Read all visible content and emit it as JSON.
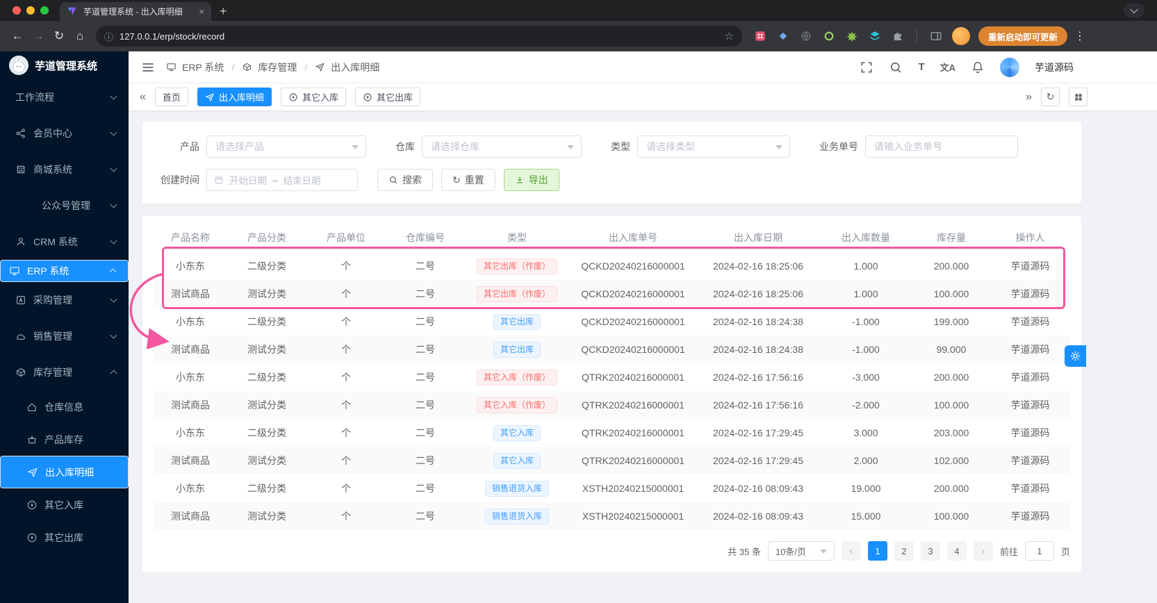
{
  "browser": {
    "tab_title": "芋道管理系统 - 出入库明细",
    "url": "127.0.0.1/erp/stock/record",
    "update_label": "重新启动即可更新"
  },
  "glyphs": {
    "back": "←",
    "forward": "→",
    "reload": "↻",
    "home": "⌂",
    "info": "ⓘ",
    "star": "☆",
    "menu_dots": "⋮",
    "new_tab": "+",
    "close_tab": "×",
    "collapse_left": "«",
    "expand_right": "»",
    "refresh": "↻",
    "size_icon": "T",
    "translate_icon": "文A",
    "page_prev": "‹",
    "page_next": "›",
    "breadcrumb_sep": "/",
    "range_sep": "–"
  },
  "sidebar": {
    "logo_text": "芋道管理系统",
    "items": [
      {
        "label": "工作流程"
      },
      {
        "label": "会员中心"
      },
      {
        "label": "商城系统"
      },
      {
        "label": "公众号管理"
      },
      {
        "label": "CRM 系统"
      },
      {
        "label": "ERP 系统"
      },
      {
        "label": "采购管理"
      },
      {
        "label": "销售管理"
      },
      {
        "label": "库存管理"
      },
      {
        "label": "仓库信息"
      },
      {
        "label": "产品库存"
      },
      {
        "label": "出入库明细"
      },
      {
        "label": "其它入库"
      },
      {
        "label": "其它出库"
      }
    ]
  },
  "header": {
    "breadcrumb": [
      {
        "label": "ERP 系统"
      },
      {
        "label": "库存管理"
      },
      {
        "label": "出入库明细"
      }
    ],
    "username": "芋道源码"
  },
  "tags": [
    {
      "label": "首页"
    },
    {
      "label": "出入库明细"
    },
    {
      "label": "其它入库"
    },
    {
      "label": "其它出库"
    }
  ],
  "filter": {
    "product_label": "产品",
    "product_placeholder": "请选择产品",
    "warehouse_label": "仓库",
    "warehouse_placeholder": "请选择仓库",
    "type_label": "类型",
    "type_placeholder": "请选择类型",
    "bizno_label": "业务单号",
    "bizno_placeholder": "请输入业务单号",
    "time_label": "创建时间",
    "time_start": "开始日期",
    "time_end": "结束日期",
    "search_label": "搜索",
    "reset_label": "重置",
    "export_label": "导出"
  },
  "table": {
    "headers": [
      "产品名称",
      "产品分类",
      "产品单位",
      "仓库编号",
      "类型",
      "出入库单号",
      "出入库日期",
      "出入库数量",
      "库存量",
      "操作人"
    ],
    "rows": [
      {
        "product": "小东东",
        "category": "二级分类",
        "unit": "个",
        "warehouse": "二号",
        "type": "其它出库（作废）",
        "type_variant": "danger",
        "order_no": "QCKD20240216000001",
        "datetime": "2024-02-16 18:25:06",
        "quantity": "1.000",
        "stock": "200.000",
        "operator": "芋道源码"
      },
      {
        "product": "测试商品",
        "category": "测试分类",
        "unit": "个",
        "warehouse": "二号",
        "type": "其它出库（作废）",
        "type_variant": "danger",
        "order_no": "QCKD20240216000001",
        "datetime": "2024-02-16 18:25:06",
        "quantity": "1.000",
        "stock": "100.000",
        "operator": "芋道源码"
      },
      {
        "product": "小东东",
        "category": "二级分类",
        "unit": "个",
        "warehouse": "二号",
        "type": "其它出库",
        "type_variant": "primary",
        "order_no": "QCKD20240216000001",
        "datetime": "2024-02-16 18:24:38",
        "quantity": "-1.000",
        "stock": "199.000",
        "operator": "芋道源码"
      },
      {
        "product": "测试商品",
        "category": "测试分类",
        "unit": "个",
        "warehouse": "二号",
        "type": "其它出库",
        "type_variant": "primary",
        "order_no": "QCKD20240216000001",
        "datetime": "2024-02-16 18:24:38",
        "quantity": "-1.000",
        "stock": "99.000",
        "operator": "芋道源码"
      },
      {
        "product": "小东东",
        "category": "二级分类",
        "unit": "个",
        "warehouse": "二号",
        "type": "其它入库（作废）",
        "type_variant": "danger",
        "order_no": "QTRK20240216000001",
        "datetime": "2024-02-16 17:56:16",
        "quantity": "-3.000",
        "stock": "200.000",
        "operator": "芋道源码"
      },
      {
        "product": "测试商品",
        "category": "测试分类",
        "unit": "个",
        "warehouse": "二号",
        "type": "其它入库（作废）",
        "type_variant": "danger",
        "order_no": "QTRK20240216000001",
        "datetime": "2024-02-16 17:56:16",
        "quantity": "-2.000",
        "stock": "100.000",
        "operator": "芋道源码"
      },
      {
        "product": "小东东",
        "category": "二级分类",
        "unit": "个",
        "warehouse": "二号",
        "type": "其它入库",
        "type_variant": "primary",
        "order_no": "QTRK20240216000001",
        "datetime": "2024-02-16 17:29:45",
        "quantity": "3.000",
        "stock": "203.000",
        "operator": "芋道源码"
      },
      {
        "product": "测试商品",
        "category": "测试分类",
        "unit": "个",
        "warehouse": "二号",
        "type": "其它入库",
        "type_variant": "primary",
        "order_no": "QTRK20240216000001",
        "datetime": "2024-02-16 17:29:45",
        "quantity": "2.000",
        "stock": "102.000",
        "operator": "芋道源码"
      },
      {
        "product": "小东东",
        "category": "二级分类",
        "unit": "个",
        "warehouse": "二号",
        "type": "销售退货入库",
        "type_variant": "primary",
        "order_no": "XSTH20240215000001",
        "datetime": "2024-02-16 08:09:43",
        "quantity": "19.000",
        "stock": "200.000",
        "operator": "芋道源码"
      },
      {
        "product": "测试商品",
        "category": "测试分类",
        "unit": "个",
        "warehouse": "二号",
        "type": "销售退货入库",
        "type_variant": "primary",
        "order_no": "XSTH20240215000001",
        "datetime": "2024-02-16 08:09:43",
        "quantity": "15.000",
        "stock": "100.000",
        "operator": "芋道源码"
      }
    ]
  },
  "pagination": {
    "total_label": "共 35 条",
    "page_size": "10条/页",
    "pages": [
      "1",
      "2",
      "3",
      "4"
    ],
    "active_page": "1",
    "goto_label": "前往",
    "goto_value": "1",
    "goto_suffix": "页"
  },
  "colors": {
    "primary": "#1890ff",
    "sidebar_bg": "#001529",
    "content_bg": "#f0f2f5",
    "danger_text": "#f56c6c",
    "danger_bg": "#fef0f0",
    "info_text": "#409eff",
    "info_bg": "#ecf5ff",
    "export_green": "#4ea72e",
    "annotation_pink": "#f2579f"
  }
}
